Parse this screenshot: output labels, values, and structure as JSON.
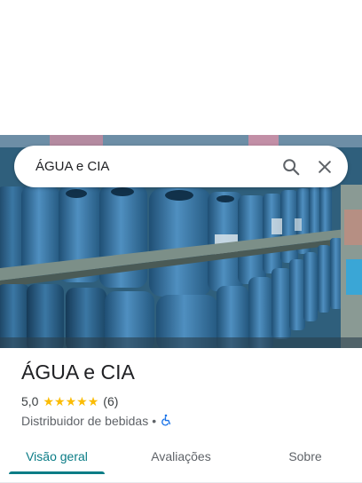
{
  "search": {
    "query": "ÁGUA e CIA",
    "search_icon": "search-icon",
    "close_icon": "close-icon"
  },
  "hero": {
    "photo": "water-gallon-bottles-photo"
  },
  "place": {
    "name": "ÁGUA e CIA",
    "rating": "5,0",
    "stars": 5,
    "review_count": "(6)",
    "category": "Distribuidor de bebidas",
    "separator": "•",
    "accessibility_icon": "wheelchair-accessible-icon"
  },
  "tabs": [
    {
      "label": "Visão geral",
      "active": true
    },
    {
      "label": "Avaliações",
      "active": false
    },
    {
      "label": "Sobre",
      "active": false
    }
  ],
  "colors": {
    "accent": "#0a7c86",
    "star": "#fbbc04",
    "accessibility": "#1a73e8"
  }
}
